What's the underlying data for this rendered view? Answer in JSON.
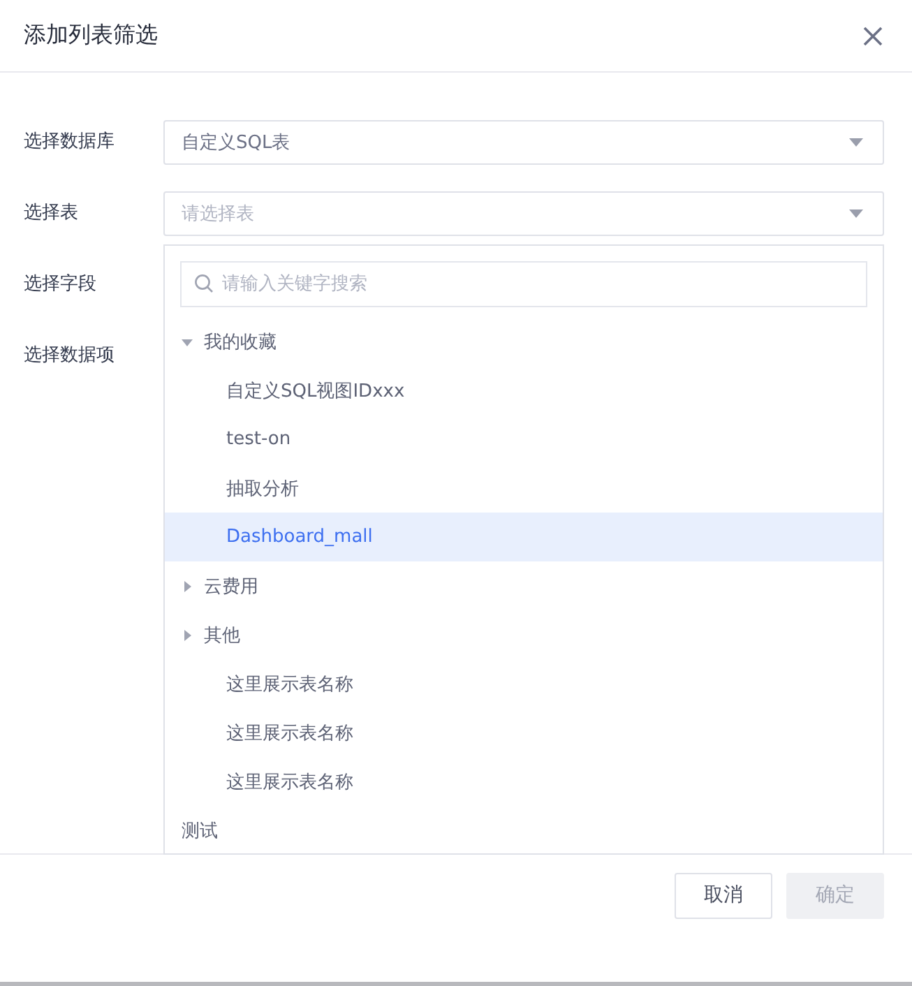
{
  "dialog": {
    "title": "添加列表筛选"
  },
  "form": {
    "labels": [
      "选择数据库",
      "选择表",
      "选择字段",
      "选择数据项"
    ],
    "database_select": {
      "value": "自定义SQL表"
    },
    "table_select": {
      "placeholder": "请选择表"
    },
    "dropdown": {
      "search": {
        "placeholder": "请输入关键字搜索"
      },
      "tree": [
        {
          "label": "我的收藏",
          "expanded": true,
          "children": [
            {
              "label": "自定义SQL视图IDxxx",
              "selected": false
            },
            {
              "label": "test-on",
              "selected": false
            },
            {
              "label": "抽取分析",
              "selected": false
            },
            {
              "label": "Dashboard_mall",
              "selected": true
            }
          ]
        },
        {
          "label": "云费用",
          "expanded": false
        },
        {
          "label": "其他",
          "expanded": false,
          "children": [
            {
              "label": "这里展示表名称",
              "selected": false
            },
            {
              "label": "这里展示表名称",
              "selected": false
            },
            {
              "label": "这里展示表名称",
              "selected": false
            }
          ]
        },
        {
          "label": "测试",
          "selected": false
        }
      ]
    }
  },
  "footer": {
    "buttons": [
      {
        "label": "取消",
        "disabled": false
      },
      {
        "label": "确定",
        "disabled": true
      }
    ]
  }
}
